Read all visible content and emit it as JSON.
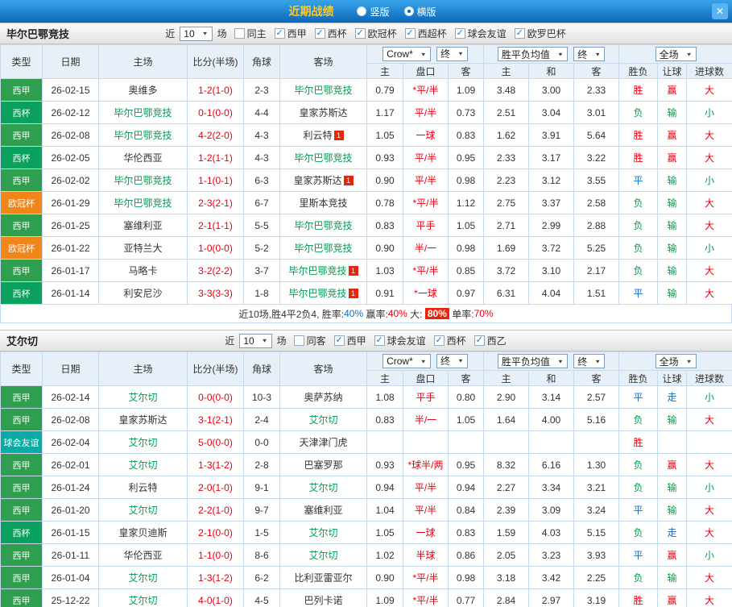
{
  "topbar": {
    "title": "近期战绩",
    "radio_vertical": "竖版",
    "radio_horizontal": "横版",
    "selected_mode": "横版",
    "close_icon": "✕"
  },
  "type_colors": {
    "西甲": "#2f9e4e",
    "西杯": "#0aa05e",
    "欧冠杯": "#f08519",
    "球会友谊": "#0aaba3"
  },
  "table_header": {
    "col_type": "类型",
    "col_date": "日期",
    "col_home": "主场",
    "col_score": "比分(半场)",
    "col_corner": "角球",
    "col_away": "客场",
    "odds_source": "Crow*",
    "odds_stage": "终",
    "europe_source": "胜平负均值",
    "europe_stage": "终",
    "scope": "全场",
    "col_h": "主",
    "col_line": "盘口",
    "col_a": "客",
    "col_win": "主",
    "col_draw": "和",
    "col_lose": "客",
    "col_result": "胜负",
    "col_handicap_result": "让球",
    "col_goals_result": "进球数"
  },
  "sections": [
    {
      "team": "毕尔巴鄂竞技",
      "filter": {
        "near_label": "近",
        "count": "10",
        "games_label": "场",
        "same_venue": {
          "label": "同主",
          "checked": false
        },
        "leagues": [
          {
            "label": "西甲",
            "checked": true
          },
          {
            "label": "西杯",
            "checked": true
          },
          {
            "label": "欧冠杯",
            "checked": true
          },
          {
            "label": "西超杯",
            "checked": true
          },
          {
            "label": "球会友谊",
            "checked": true
          },
          {
            "label": "欧罗巴杯",
            "checked": true
          }
        ]
      },
      "rows": [
        {
          "type": "西甲",
          "date": "26-02-15",
          "home": "奥维多",
          "home_hl": false,
          "home_rc": false,
          "score": "1-2(1-0)",
          "corner": "2-3",
          "away": "毕尔巴鄂竞技",
          "away_hl": true,
          "away_rc": false,
          "h": "0.79",
          "line": "*平/半",
          "a": "1.09",
          "w": "3.48",
          "d": "3.00",
          "l": "2.33",
          "res": [
            [
              "胜",
              "red"
            ],
            [
              "赢",
              "red"
            ],
            [
              "大",
              "red"
            ]
          ]
        },
        {
          "type": "西杯",
          "date": "26-02-12",
          "home": "毕尔巴鄂竞技",
          "home_hl": true,
          "home_rc": false,
          "score": "0-1(0-0)",
          "corner": "4-4",
          "away": "皇家苏斯达",
          "away_hl": false,
          "away_rc": false,
          "h": "1.17",
          "line": "平/半",
          "a": "0.73",
          "w": "2.51",
          "d": "3.04",
          "l": "3.01",
          "res": [
            [
              "负",
              "green"
            ],
            [
              "输",
              "green"
            ],
            [
              "小",
              "green"
            ]
          ]
        },
        {
          "type": "西甲",
          "date": "26-02-08",
          "home": "毕尔巴鄂竞技",
          "home_hl": true,
          "home_rc": false,
          "score": "4-2(2-0)",
          "corner": "4-3",
          "away": "利云特",
          "away_hl": false,
          "away_rc": true,
          "h": "1.05",
          "line": "一球",
          "a": "0.83",
          "w": "1.62",
          "d": "3.91",
          "l": "5.64",
          "res": [
            [
              "胜",
              "red"
            ],
            [
              "赢",
              "red"
            ],
            [
              "大",
              "red"
            ]
          ]
        },
        {
          "type": "西杯",
          "date": "26-02-05",
          "home": "华伦西亚",
          "home_hl": false,
          "home_rc": false,
          "score": "1-2(1-1)",
          "corner": "4-3",
          "away": "毕尔巴鄂竞技",
          "away_hl": true,
          "away_rc": false,
          "h": "0.93",
          "line": "平/半",
          "a": "0.95",
          "w": "2.33",
          "d": "3.17",
          "l": "3.22",
          "res": [
            [
              "胜",
              "red"
            ],
            [
              "赢",
              "red"
            ],
            [
              "大",
              "red"
            ]
          ]
        },
        {
          "type": "西甲",
          "date": "26-02-02",
          "home": "毕尔巴鄂竞技",
          "home_hl": true,
          "home_rc": false,
          "score": "1-1(0-1)",
          "corner": "6-3",
          "away": "皇家苏斯达",
          "away_hl": false,
          "away_rc": true,
          "h": "0.90",
          "line": "平/半",
          "a": "0.98",
          "w": "2.23",
          "d": "3.12",
          "l": "3.55",
          "res": [
            [
              "平",
              "blue"
            ],
            [
              "输",
              "green"
            ],
            [
              "小",
              "green"
            ]
          ]
        },
        {
          "type": "欧冠杯",
          "date": "26-01-29",
          "home": "毕尔巴鄂竞技",
          "home_hl": true,
          "home_rc": false,
          "score": "2-3(2-1)",
          "corner": "6-7",
          "away": "里斯本竞技",
          "away_hl": false,
          "away_rc": false,
          "h": "0.78",
          "line": "*平/半",
          "a": "1.12",
          "w": "2.75",
          "d": "3.37",
          "l": "2.58",
          "res": [
            [
              "负",
              "green"
            ],
            [
              "输",
              "green"
            ],
            [
              "大",
              "red"
            ]
          ]
        },
        {
          "type": "西甲",
          "date": "26-01-25",
          "home": "塞维利亚",
          "home_hl": false,
          "home_rc": false,
          "score": "2-1(1-1)",
          "corner": "5-5",
          "away": "毕尔巴鄂竞技",
          "away_hl": true,
          "away_rc": false,
          "h": "0.83",
          "line": "平手",
          "a": "1.05",
          "w": "2.71",
          "d": "2.99",
          "l": "2.88",
          "res": [
            [
              "负",
              "green"
            ],
            [
              "输",
              "green"
            ],
            [
              "大",
              "red"
            ]
          ]
        },
        {
          "type": "欧冠杯",
          "date": "26-01-22",
          "home": "亚特兰大",
          "home_hl": false,
          "home_rc": false,
          "score": "1-0(0-0)",
          "corner": "5-2",
          "away": "毕尔巴鄂竞技",
          "away_hl": true,
          "away_rc": false,
          "h": "0.90",
          "line": "半/一",
          "a": "0.98",
          "w": "1.69",
          "d": "3.72",
          "l": "5.25",
          "res": [
            [
              "负",
              "green"
            ],
            [
              "输",
              "green"
            ],
            [
              "小",
              "green"
            ]
          ]
        },
        {
          "type": "西甲",
          "date": "26-01-17",
          "home": "马略卡",
          "home_hl": false,
          "home_rc": false,
          "score": "3-2(2-2)",
          "corner": "3-7",
          "away": "毕尔巴鄂竞技",
          "away_hl": true,
          "away_rc": true,
          "h": "1.03",
          "line": "*平/半",
          "a": "0.85",
          "w": "3.72",
          "d": "3.10",
          "l": "2.17",
          "res": [
            [
              "负",
              "green"
            ],
            [
              "输",
              "green"
            ],
            [
              "大",
              "red"
            ]
          ]
        },
        {
          "type": "西杯",
          "date": "26-01-14",
          "home": "利安尼沙",
          "home_hl": false,
          "home_rc": false,
          "score": "3-3(3-3)",
          "corner": "1-8",
          "away": "毕尔巴鄂竞技",
          "away_hl": true,
          "away_rc": true,
          "h": "0.91",
          "line": "*一球",
          "a": "0.97",
          "w": "6.31",
          "d": "4.04",
          "l": "1.51",
          "res": [
            [
              "平",
              "blue"
            ],
            [
              "输",
              "green"
            ],
            [
              "大",
              "red"
            ]
          ]
        }
      ],
      "summary": [
        {
          "text": "近10场,胜4平2负4, 胜率:",
          "cls": "k"
        },
        {
          "text": "40%",
          "cls": "blue"
        },
        {
          "text": " 赢率:",
          "cls": "k"
        },
        {
          "text": "40%",
          "cls": "red"
        },
        {
          "text": " 大: ",
          "cls": "k"
        },
        {
          "text": "80%",
          "cls": "hl"
        },
        {
          "text": " 单率:",
          "cls": "k"
        },
        {
          "text": "70%",
          "cls": "red"
        }
      ]
    },
    {
      "team": "艾尔切",
      "filter": {
        "near_label": "近",
        "count": "10",
        "games_label": "场",
        "same_venue": {
          "label": "同客",
          "checked": false
        },
        "leagues": [
          {
            "label": "西甲",
            "checked": true
          },
          {
            "label": "球会友谊",
            "checked": true
          },
          {
            "label": "西杯",
            "checked": true
          },
          {
            "label": "西乙",
            "checked": true
          }
        ]
      },
      "rows": [
        {
          "type": "西甲",
          "date": "26-02-14",
          "home": "艾尔切",
          "home_hl": true,
          "home_rc": false,
          "score": "0-0(0-0)",
          "corner": "10-3",
          "away": "奥萨苏纳",
          "away_hl": false,
          "away_rc": false,
          "h": "1.08",
          "line": "平手",
          "a": "0.80",
          "w": "2.90",
          "d": "3.14",
          "l": "2.57",
          "res": [
            [
              "平",
              "blue"
            ],
            [
              "走",
              "blue"
            ],
            [
              "小",
              "green"
            ]
          ]
        },
        {
          "type": "西甲",
          "date": "26-02-08",
          "home": "皇家苏斯达",
          "home_hl": false,
          "home_rc": false,
          "score": "3-1(2-1)",
          "corner": "2-4",
          "away": "艾尔切",
          "away_hl": true,
          "away_rc": false,
          "h": "0.83",
          "line": "半/一",
          "a": "1.05",
          "w": "1.64",
          "d": "4.00",
          "l": "5.16",
          "res": [
            [
              "负",
              "green"
            ],
            [
              "输",
              "green"
            ],
            [
              "大",
              "red"
            ]
          ]
        },
        {
          "type": "球会友谊",
          "date": "26-02-04",
          "home": "艾尔切",
          "home_hl": true,
          "home_rc": false,
          "score": "5-0(0-0)",
          "corner": "0-0",
          "away": "天津津门虎",
          "away_hl": false,
          "away_rc": false,
          "h": "",
          "line": "",
          "a": "",
          "w": "",
          "d": "",
          "l": "",
          "res": [
            [
              "胜",
              "red"
            ],
            [
              "",
              ""
            ],
            [
              "",
              ""
            ]
          ]
        },
        {
          "type": "西甲",
          "date": "26-02-01",
          "home": "艾尔切",
          "home_hl": true,
          "home_rc": false,
          "score": "1-3(1-2)",
          "corner": "2-8",
          "away": "巴塞罗那",
          "away_hl": false,
          "away_rc": false,
          "h": "0.93",
          "line": "*球半/两",
          "a": "0.95",
          "w": "8.32",
          "d": "6.16",
          "l": "1.30",
          "res": [
            [
              "负",
              "green"
            ],
            [
              "赢",
              "red"
            ],
            [
              "大",
              "red"
            ]
          ]
        },
        {
          "type": "西甲",
          "date": "26-01-24",
          "home": "利云特",
          "home_hl": false,
          "home_rc": false,
          "score": "2-0(1-0)",
          "corner": "9-1",
          "away": "艾尔切",
          "away_hl": true,
          "away_rc": false,
          "h": "0.94",
          "line": "平/半",
          "a": "0.94",
          "w": "2.27",
          "d": "3.34",
          "l": "3.21",
          "res": [
            [
              "负",
              "green"
            ],
            [
              "输",
              "green"
            ],
            [
              "小",
              "green"
            ]
          ]
        },
        {
          "type": "西甲",
          "date": "26-01-20",
          "home": "艾尔切",
          "home_hl": true,
          "home_rc": false,
          "score": "2-2(1-0)",
          "corner": "9-7",
          "away": "塞维利亚",
          "away_hl": false,
          "away_rc": false,
          "h": "1.04",
          "line": "平/半",
          "a": "0.84",
          "w": "2.39",
          "d": "3.09",
          "l": "3.24",
          "res": [
            [
              "平",
              "blue"
            ],
            [
              "输",
              "green"
            ],
            [
              "大",
              "red"
            ]
          ]
        },
        {
          "type": "西杯",
          "date": "26-01-15",
          "home": "皇家贝迪斯",
          "home_hl": false,
          "home_rc": false,
          "score": "2-1(0-0)",
          "corner": "1-5",
          "away": "艾尔切",
          "away_hl": true,
          "away_rc": false,
          "h": "1.05",
          "line": "一球",
          "a": "0.83",
          "w": "1.59",
          "d": "4.03",
          "l": "5.15",
          "res": [
            [
              "负",
              "green"
            ],
            [
              "走",
              "blue"
            ],
            [
              "大",
              "red"
            ]
          ]
        },
        {
          "type": "西甲",
          "date": "26-01-11",
          "home": "华伦西亚",
          "home_hl": false,
          "home_rc": false,
          "score": "1-1(0-0)",
          "corner": "8-6",
          "away": "艾尔切",
          "away_hl": true,
          "away_rc": false,
          "h": "1.02",
          "line": "半球",
          "a": "0.86",
          "w": "2.05",
          "d": "3.23",
          "l": "3.93",
          "res": [
            [
              "平",
              "blue"
            ],
            [
              "赢",
              "red"
            ],
            [
              "小",
              "green"
            ]
          ]
        },
        {
          "type": "西甲",
          "date": "26-01-04",
          "home": "艾尔切",
          "home_hl": true,
          "home_rc": false,
          "score": "1-3(1-2)",
          "corner": "6-2",
          "away": "比利亚雷亚尔",
          "away_hl": false,
          "away_rc": false,
          "h": "0.90",
          "line": "*平/半",
          "a": "0.98",
          "w": "3.18",
          "d": "3.42",
          "l": "2.25",
          "res": [
            [
              "负",
              "green"
            ],
            [
              "输",
              "green"
            ],
            [
              "大",
              "red"
            ]
          ]
        },
        {
          "type": "西甲",
          "date": "25-12-22",
          "home": "艾尔切",
          "home_hl": true,
          "home_rc": false,
          "score": "4-0(1-0)",
          "corner": "4-5",
          "away": "巴列卡诺",
          "away_hl": false,
          "away_rc": false,
          "h": "1.09",
          "line": "*平/半",
          "a": "0.77",
          "w": "2.84",
          "d": "2.97",
          "l": "3.19",
          "res": [
            [
              "胜",
              "red"
            ],
            [
              "赢",
              "red"
            ],
            [
              "大",
              "red"
            ]
          ]
        }
      ],
      "summary": null
    }
  ]
}
